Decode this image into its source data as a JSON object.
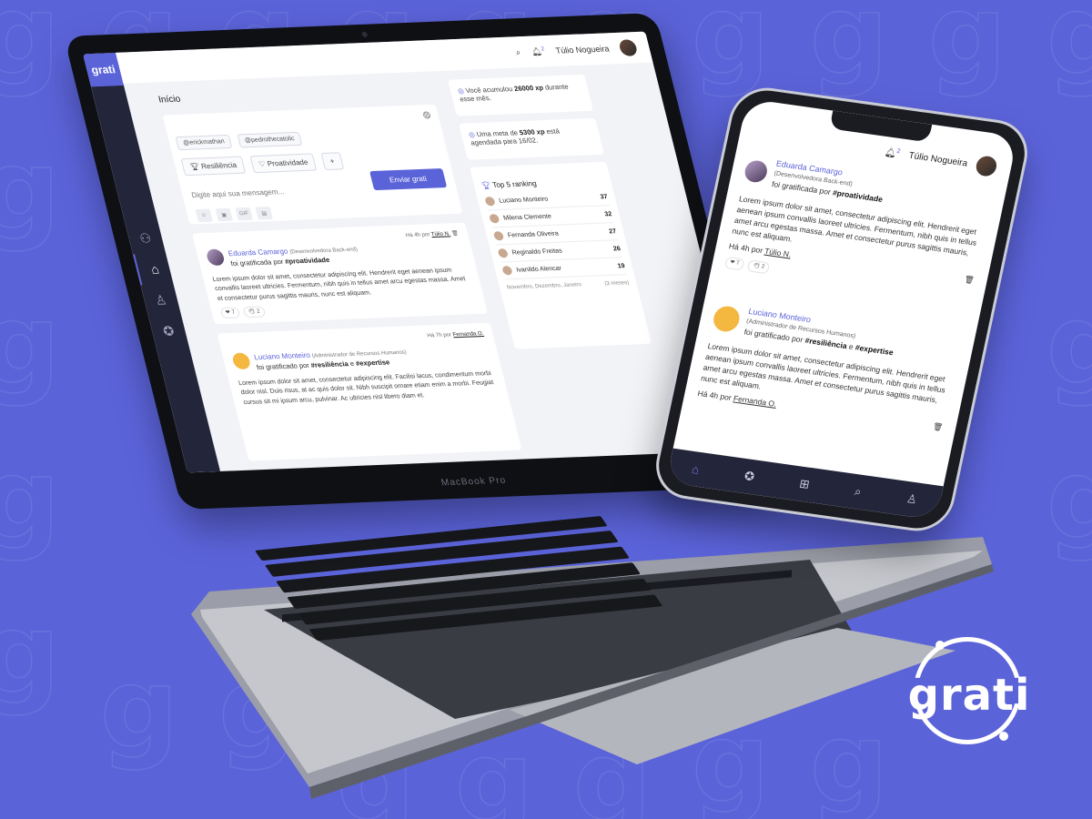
{
  "colors": {
    "background": "#5b63d9",
    "accent": "#5b63d9",
    "sidebar": "#23253a"
  },
  "brand": {
    "logo_text": "grati",
    "laptop_label": "MacBook Pro"
  },
  "topbar": {
    "user_name": "Túlio Nogueira",
    "notification_count": "2"
  },
  "page": {
    "title": "Início"
  },
  "composer": {
    "recipients": [
      "@erickmathan",
      "@pedrothecatolic"
    ],
    "tags": [
      "Resiliência",
      "Proatividade"
    ],
    "add_label": "+",
    "placeholder": "Digite aqui sua mensagem...",
    "send_label": "Enviar grati",
    "gif_label": "GIF"
  },
  "posts": [
    {
      "name": "Eduarda Camargo",
      "role": "(Desenvolvedora Back-end)",
      "tag_prefix": "foi gratificada por",
      "tag": "#proatividade",
      "meta_prefix": "Há 4h por",
      "meta_author": "Túlio N.",
      "body": "Lorem ipsum dolor sit amet, consectetur adipiscing elit. Hendrerit eget aenean ipsum convallis laoreet ultricies. Fermentum, nibh quis in tellus amet arcu egestas massa. Amet et consectetur purus sagittis mauris, nunc est aliquam.",
      "reactions": [
        "7",
        "2"
      ]
    },
    {
      "name": "Luciano Monteiro",
      "role": "(Administrador de Recursos Humanos)",
      "tag_prefix": "foi gratificado por",
      "tag": "#resiliência",
      "tag_join": "e",
      "tag2": "#expertise",
      "meta_prefix": "Há 7h por",
      "meta_author": "Fernanda O.",
      "body": "Lorem ipsum dolor sit amet, consectetur adipiscing elit. Facilisi lacus, condimentum morbi dolor nisl. Duis risus, at ac quis dolor sit. Nibh suscipit ornare etiam enim a morbi. Feugiat cursus sit mi ipsum arcu, pulvinar. Ac ultricies nisl libero diam et."
    }
  ],
  "xp_card": {
    "prefix": "Você acumulou",
    "value": "26000 xp",
    "suffix": "durante esse mês."
  },
  "goal_card": {
    "prefix": "Uma meta de",
    "value": "5300 xp",
    "suffix": "está agendada para 16/02."
  },
  "ranking": {
    "title": "Top 5 ranking",
    "rows": [
      {
        "name": "Luciano Monteiro",
        "score": "37"
      },
      {
        "name": "Milena Clemente",
        "score": "32"
      },
      {
        "name": "Fernanda Oliveira",
        "score": "27"
      },
      {
        "name": "Reginaldo Freitas",
        "score": "26"
      },
      {
        "name": "Ivanildo Alencar",
        "score": "19"
      }
    ],
    "footer_months": "Novembro, Dezembro, Janeiro",
    "footer_range": "(3 meses)"
  },
  "phone": {
    "user_name": "Túlio Nogueira",
    "notification_count": "2",
    "posts": [
      {
        "name": "Eduarda Camargo",
        "role": "(Desenvolvedora Back-end)",
        "tag_prefix": "foi gratificada por",
        "tag": "#proatividade",
        "body": "Lorem ipsum dolor sit amet, consectetur adipiscing elit. Hendrerit eget aenean ipsum convallis laoreet ultricies. Fermentum, nibh quis in tellus amet arcu egestas massa. Amet et consectetur purus sagittis mauris, nunc est aliquam.",
        "meta_prefix": "Há 4h por",
        "meta_author": "Túlio N.",
        "reactions": [
          "7",
          "2"
        ]
      },
      {
        "name": "Luciano Monteiro",
        "role": "(Administrador de Recursos Humanos)",
        "tag_prefix": "foi gratificado por",
        "tag": "#resiliência",
        "tag_join": "e",
        "tag2": "#expertise",
        "body": "Lorem ipsum dolor sit amet, consectetur adipiscing elit. Hendrerit eget aenean ipsum convallis laoreet ultricies. Fermentum, nibh quis in tellus amet arcu egestas massa. Amet et consectetur purus sagittis mauris, nunc est aliquam.",
        "meta_prefix": "Há 4h por",
        "meta_author": "Fernanda O."
      }
    ]
  }
}
